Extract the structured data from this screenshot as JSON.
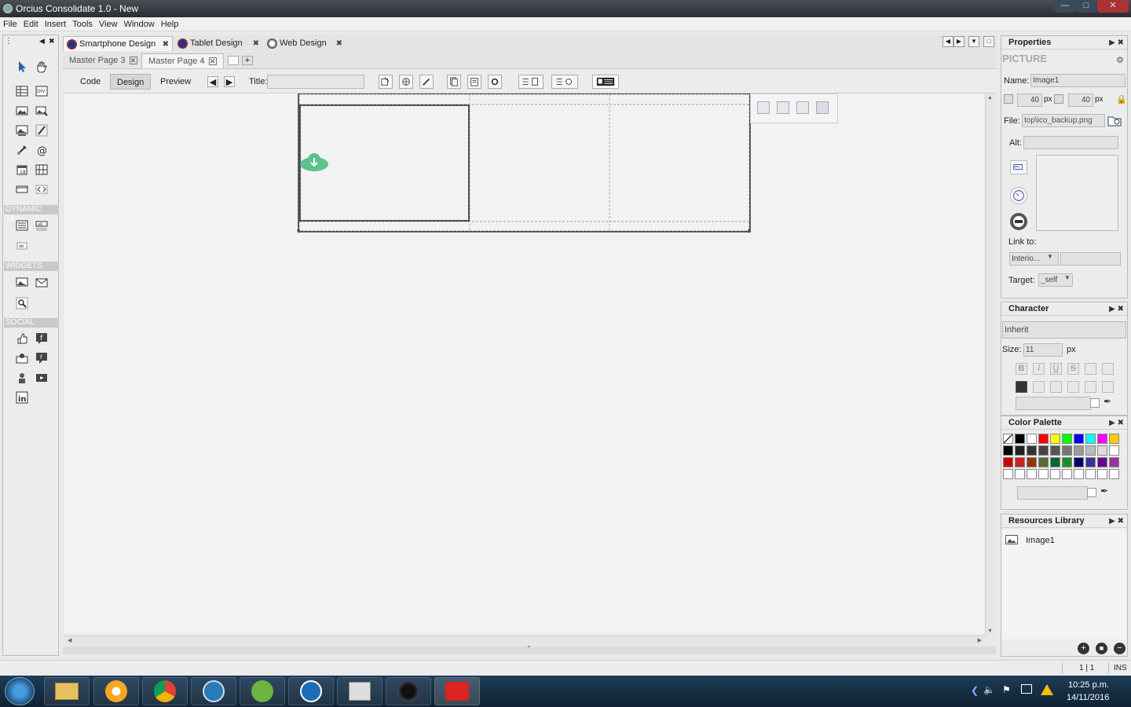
{
  "window": {
    "title": "Orcius Consolidate 1.0 - New"
  },
  "menu": [
    "File",
    "Edit",
    "Insert",
    "Tools",
    "View",
    "Window",
    "Help"
  ],
  "left_toolbar": {
    "sections": [
      "DYNAMIC TA...",
      "WIDGETS",
      "SOCIAL"
    ]
  },
  "doc_tabs": [
    {
      "label": "Smartphone Design",
      "active": true
    },
    {
      "label": "Tablet Design",
      "active": false
    },
    {
      "label": "Web Design",
      "active": false
    }
  ],
  "page_tabs": [
    {
      "label": "Master Page 3",
      "active": false
    },
    {
      "label": "Master Page 4",
      "active": true
    }
  ],
  "view_modes": {
    "code": "Code",
    "design": "Design",
    "preview": "Preview",
    "selected": "Design"
  },
  "title_field": {
    "label": "Title:",
    "value": ""
  },
  "properties": {
    "header": "Properties",
    "type": "PICTURE",
    "name_label": "Name:",
    "name_value": "Image1",
    "width": "40",
    "height": "40",
    "unit": "px",
    "file_label": "File:",
    "file_value": "top\\ico_backup.png",
    "alt_label": "Alt:",
    "alt_value": "",
    "link_label": "Link to:",
    "link_value": "Interio...",
    "target_label": "Target:",
    "target_value": "_self"
  },
  "character": {
    "header": "Character",
    "font": "Inherit",
    "size_label": "Size:",
    "size_value": "11",
    "size_unit": "px"
  },
  "color_palette": {
    "header": "Color Palette",
    "rows": [
      [
        "none",
        "#000000",
        "#ffffff",
        "#ff0000",
        "#ffff00",
        "#00ff00",
        "#0000ff",
        "#00ffff",
        "#ff00ff",
        "#ffcc00"
      ],
      [
        "#000000",
        "#222222",
        "#333333",
        "#444444",
        "#555555",
        "#777777",
        "#999999",
        "#bbbbbb",
        "#dddddd",
        "#ffffff"
      ],
      [
        "#cc0000",
        "#cc2222",
        "#993300",
        "#556b2f",
        "#006633",
        "#228b22",
        "#000066",
        "#333399",
        "#660099",
        "#993399"
      ],
      [
        "#ffffff",
        "#ffffff",
        "#ffffff",
        "#ffffff",
        "#ffffff",
        "#ffffff",
        "#ffffff",
        "#ffffff",
        "#ffffff",
        "#ffffff"
      ]
    ]
  },
  "resources": {
    "header": "Resources Library",
    "items": [
      "Image1"
    ]
  },
  "status": {
    "pos": "1 | 1",
    "mode": "INS"
  },
  "taskbar": {
    "time": "10:25 p.m.",
    "date": "14/11/2016"
  }
}
